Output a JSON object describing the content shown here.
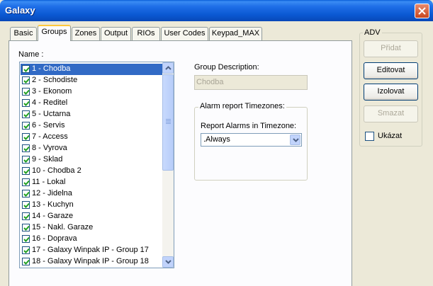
{
  "window": {
    "title": "Galaxy"
  },
  "tabs": [
    {
      "label": "Basic",
      "active": false
    },
    {
      "label": "Groups",
      "active": true
    },
    {
      "label": "Zones",
      "active": false
    },
    {
      "label": "Output",
      "active": false
    },
    {
      "label": "RIOs",
      "active": false
    },
    {
      "label": "User Codes",
      "active": false
    },
    {
      "label": "Keypad_MAX",
      "active": false
    }
  ],
  "groups_panel": {
    "name_label": "Name :",
    "items": [
      {
        "label": "1 - Chodba",
        "checked": true,
        "selected": true
      },
      {
        "label": "2 - Schodiste",
        "checked": true
      },
      {
        "label": "3 - Ekonom",
        "checked": true
      },
      {
        "label": "4 - Reditel",
        "checked": true
      },
      {
        "label": "5 - Uctarna",
        "checked": true
      },
      {
        "label": "6 - Servis",
        "checked": true
      },
      {
        "label": "7 - Access",
        "checked": true
      },
      {
        "label": "8 - Vyrova",
        "checked": true
      },
      {
        "label": "9 - Sklad",
        "checked": true
      },
      {
        "label": "10 - Chodba 2",
        "checked": true
      },
      {
        "label": "11 - Lokal",
        "checked": true
      },
      {
        "label": "12 - Jidelna",
        "checked": true
      },
      {
        "label": "13 - Kuchyn",
        "checked": true
      },
      {
        "label": "14 - Garaze",
        "checked": true
      },
      {
        "label": "15 - Nakl. Garaze",
        "checked": true
      },
      {
        "label": "16 - Doprava",
        "checked": true
      },
      {
        "label": "17 - Galaxy Winpak IP - Group 17",
        "checked": true
      },
      {
        "label": "18 - Galaxy Winpak IP - Group 18",
        "checked": true
      }
    ],
    "group_description_label": "Group Description:",
    "group_description_value": "Chodba",
    "alarm_group_title": "Alarm report Timezones:",
    "report_alarms_label": "Report Alarms in Timezone:",
    "timezone_selected": ".Always"
  },
  "adv": {
    "title": "ADV",
    "buttons": [
      {
        "label": "Přidat",
        "enabled": false
      },
      {
        "label": "Editovat",
        "enabled": true
      },
      {
        "label": "Izolovat",
        "enabled": true
      },
      {
        "label": "Smazat",
        "enabled": false
      }
    ],
    "show_checkbox_label": "Ukázat",
    "show_checked": false
  }
}
